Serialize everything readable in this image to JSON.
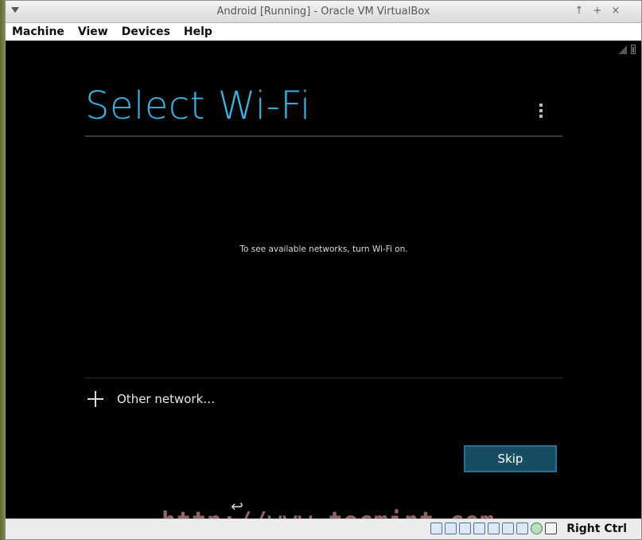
{
  "window": {
    "title": "Android [Running] - Oracle VM VirtualBox",
    "controls": [
      "↑",
      "+",
      "×"
    ]
  },
  "menu": [
    "Machine",
    "View",
    "Devices",
    "Help"
  ],
  "android": {
    "title": "Select Wi-Fi",
    "hint": "To see available networks, turn Wi-Fi on.",
    "other_network": "Other network…",
    "skip": "Skip",
    "back_icon": "↩"
  },
  "watermark": "http://www.tecmint.com",
  "statusbar": {
    "host_key": "Right Ctrl"
  },
  "colors": {
    "accent": "#33b5e5",
    "button_bg": "#174d62"
  }
}
